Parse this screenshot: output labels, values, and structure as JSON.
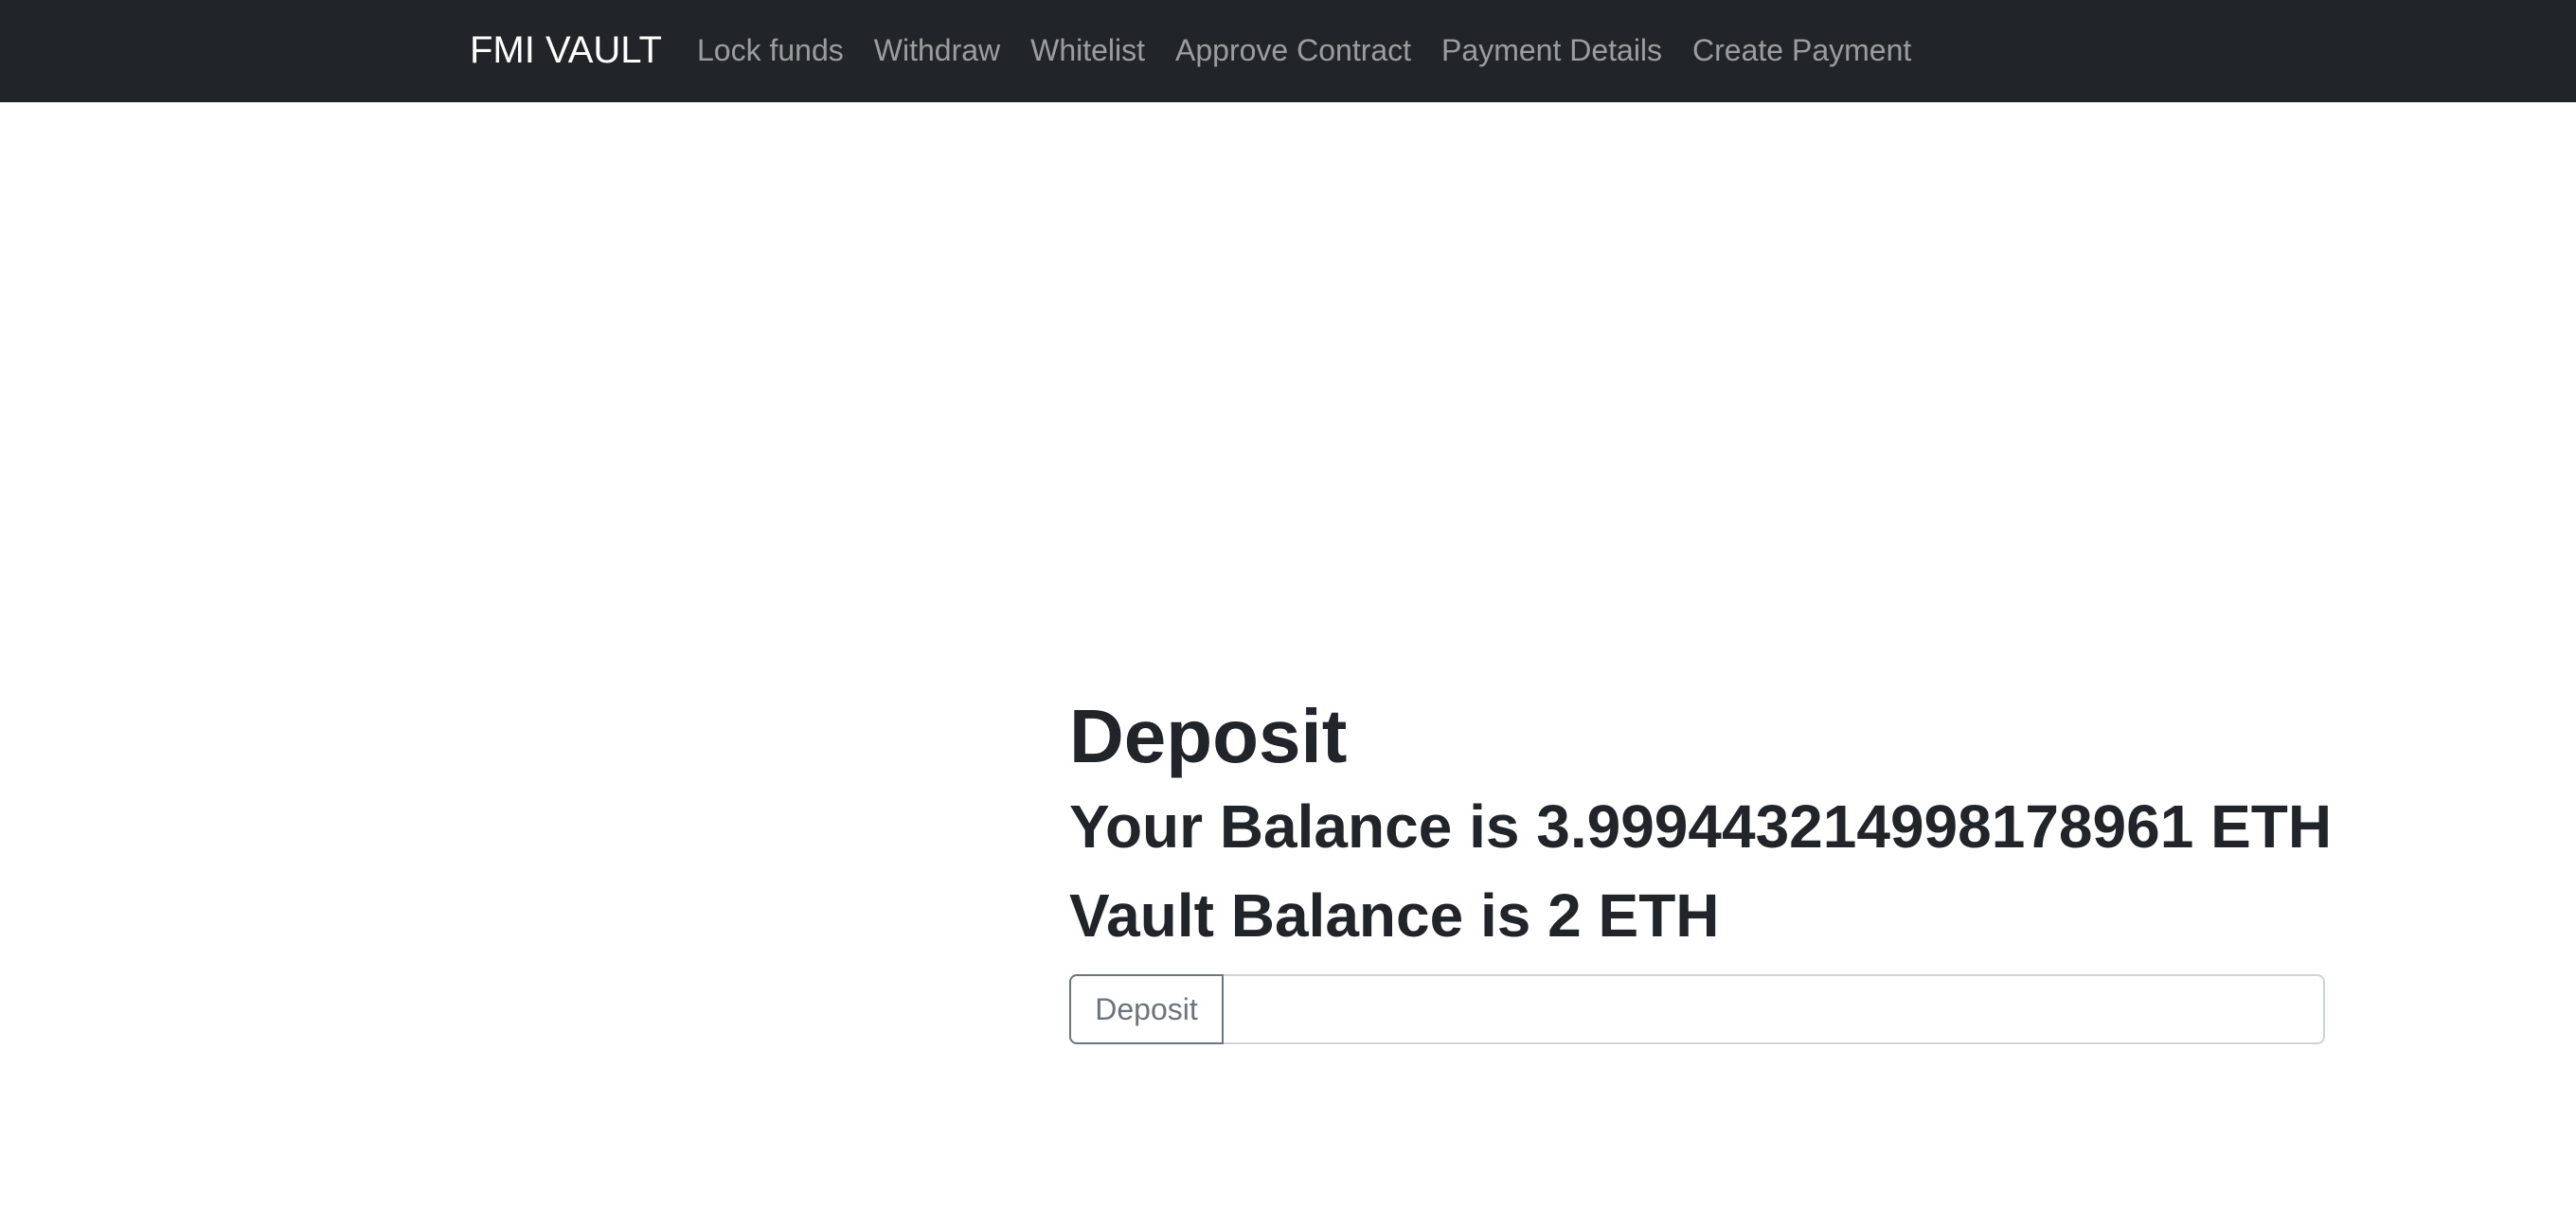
{
  "navbar": {
    "brand": "FMI VAULT",
    "links": [
      {
        "label": "Lock funds"
      },
      {
        "label": "Withdraw"
      },
      {
        "label": "Whitelist"
      },
      {
        "label": "Approve Contract"
      },
      {
        "label": "Payment Details"
      },
      {
        "label": "Create Payment"
      }
    ]
  },
  "main": {
    "title": "Deposit",
    "user_balance": "Your Balance is 3.999443214998178961 ETH",
    "vault_balance": "Vault Balance is 2 ETH",
    "deposit_button": "Deposit",
    "amount_input": {
      "value": "",
      "placeholder": ""
    }
  },
  "colors": {
    "navbar_bg": "#212529",
    "brand_text": "#ffffff",
    "nav_link_text": "rgba(255,255,255,0.55)",
    "heading_text": "#212529",
    "button_outline": "#6c757d"
  }
}
